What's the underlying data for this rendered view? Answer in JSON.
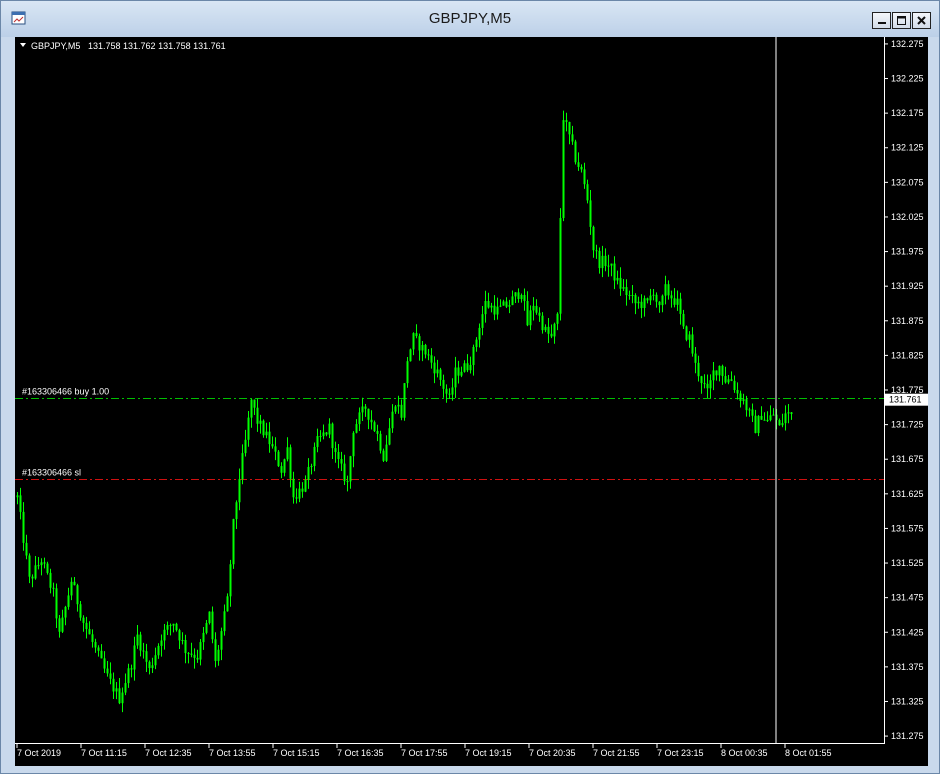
{
  "window": {
    "title": "GBPJPY,M5",
    "icon": "chart-window-icon",
    "controls": [
      "minimize-icon",
      "restore-icon",
      "close-icon"
    ]
  },
  "chart_info": {
    "symbol": "GBPJPY,M5",
    "ohlc": "131.758 131.762 131.758 131.761",
    "current_price": "131.761"
  },
  "colors": {
    "background": "#000000",
    "candle": "#00ff00",
    "text": "#ffffff",
    "buy_line": "#00c000",
    "sl_line": "#d01010",
    "crosshair": "#ffffff"
  },
  "chart_data": {
    "type": "candlestick",
    "title": "GBPJPY,M5",
    "ylim": [
      131.265,
      132.285
    ],
    "y_ticks": [
      "132.275",
      "132.225",
      "132.175",
      "132.125",
      "132.075",
      "132.025",
      "131.975",
      "131.925",
      "131.875",
      "131.825",
      "131.775",
      "131.725",
      "131.675",
      "131.625",
      "131.575",
      "131.525",
      "131.475",
      "131.425",
      "131.375",
      "131.325",
      "131.275"
    ],
    "x_ticks": [
      "7 Oct 2019",
      "7 Oct 11:15",
      "7 Oct 12:35",
      "7 Oct 13:55",
      "7 Oct 15:15",
      "7 Oct 16:35",
      "7 Oct 17:55",
      "7 Oct 19:15",
      "7 Oct 20:35",
      "7 Oct 21:55",
      "7 Oct 23:15",
      "8 Oct 00:35",
      "8 Oct 01:55"
    ],
    "close_path": [
      [
        0,
        131.62
      ],
      [
        4,
        131.5
      ],
      [
        8,
        131.53
      ],
      [
        12,
        131.48
      ],
      [
        14,
        131.42
      ],
      [
        18,
        131.5
      ],
      [
        22,
        131.44
      ],
      [
        26,
        131.4
      ],
      [
        30,
        131.36
      ],
      [
        34,
        131.33
      ],
      [
        38,
        131.38
      ],
      [
        40,
        131.42
      ],
      [
        44,
        131.37
      ],
      [
        48,
        131.42
      ],
      [
        52,
        131.44
      ],
      [
        56,
        131.4
      ],
      [
        60,
        131.39
      ],
      [
        64,
        131.45
      ],
      [
        66,
        131.38
      ],
      [
        70,
        131.47
      ],
      [
        72,
        131.58
      ],
      [
        74,
        131.65
      ],
      [
        76,
        131.7
      ],
      [
        78,
        131.76
      ],
      [
        80,
        131.73
      ],
      [
        84,
        131.7
      ],
      [
        88,
        131.66
      ],
      [
        90,
        131.69
      ],
      [
        92,
        131.62
      ],
      [
        96,
        131.64
      ],
      [
        100,
        131.7
      ],
      [
        104,
        131.72
      ],
      [
        106,
        131.68
      ],
      [
        110,
        131.64
      ],
      [
        112,
        131.72
      ],
      [
        116,
        131.75
      ],
      [
        120,
        131.71
      ],
      [
        122,
        131.68
      ],
      [
        126,
        131.76
      ],
      [
        128,
        131.74
      ],
      [
        130,
        131.82
      ],
      [
        132,
        131.85
      ],
      [
        134,
        131.84
      ],
      [
        136,
        131.83
      ],
      [
        140,
        131.8
      ],
      [
        142,
        131.78
      ],
      [
        144,
        131.76
      ],
      [
        146,
        131.8
      ],
      [
        150,
        131.81
      ],
      [
        152,
        131.83
      ],
      [
        154,
        131.87
      ],
      [
        156,
        131.9
      ],
      [
        160,
        131.89
      ],
      [
        164,
        131.9
      ],
      [
        168,
        131.92
      ],
      [
        170,
        131.87
      ],
      [
        172,
        131.9
      ],
      [
        174,
        131.88
      ],
      [
        176,
        131.86
      ],
      [
        178,
        131.85
      ],
      [
        180,
        131.88
      ],
      [
        182,
        132.17
      ],
      [
        184,
        132.14
      ],
      [
        186,
        132.11
      ],
      [
        188,
        132.09
      ],
      [
        190,
        132.05
      ],
      [
        192,
        131.98
      ],
      [
        194,
        131.96
      ],
      [
        196,
        131.96
      ],
      [
        198,
        131.95
      ],
      [
        200,
        131.93
      ],
      [
        202,
        131.92
      ],
      [
        204,
        131.91
      ],
      [
        206,
        131.9
      ],
      [
        210,
        131.9
      ],
      [
        212,
        131.92
      ],
      [
        214,
        131.89
      ],
      [
        216,
        131.92
      ],
      [
        218,
        131.91
      ],
      [
        220,
        131.9
      ],
      [
        222,
        131.86
      ],
      [
        224,
        131.85
      ],
      [
        226,
        131.81
      ],
      [
        228,
        131.79
      ],
      [
        230,
        131.77
      ],
      [
        232,
        131.8
      ],
      [
        234,
        131.81
      ],
      [
        236,
        131.79
      ],
      [
        238,
        131.79
      ],
      [
        240,
        131.77
      ],
      [
        242,
        131.76
      ],
      [
        244,
        131.74
      ],
      [
        246,
        131.72
      ],
      [
        248,
        131.74
      ],
      [
        250,
        131.73
      ],
      [
        252,
        131.74
      ],
      [
        254,
        131.72
      ],
      [
        256,
        131.74
      ],
      [
        258,
        131.74
      ],
      [
        260,
        131.75
      ],
      [
        262,
        131.761
      ]
    ],
    "orders": [
      {
        "label": "#163306466 buy 1.00",
        "price": 131.764,
        "color": "#00c000"
      },
      {
        "label": "#163306466 sl",
        "price": 131.647,
        "color": "#d01010"
      }
    ]
  }
}
